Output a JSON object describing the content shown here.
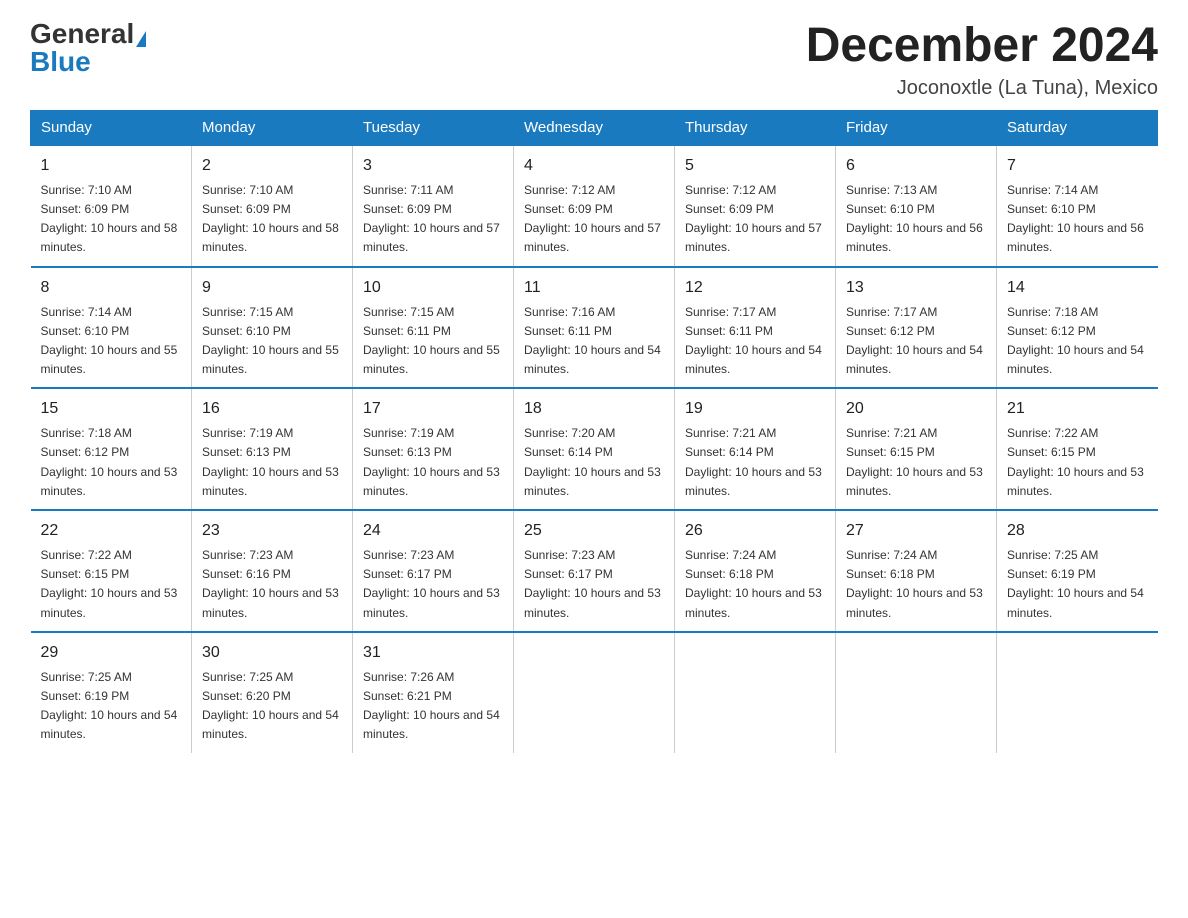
{
  "logo": {
    "general": "General",
    "blue": "Blue"
  },
  "title": "December 2024",
  "location": "Joconoxtle (La Tuna), Mexico",
  "days_of_week": [
    "Sunday",
    "Monday",
    "Tuesday",
    "Wednesday",
    "Thursday",
    "Friday",
    "Saturday"
  ],
  "weeks": [
    [
      {
        "day": "1",
        "sunrise": "7:10 AM",
        "sunset": "6:09 PM",
        "daylight": "10 hours and 58 minutes."
      },
      {
        "day": "2",
        "sunrise": "7:10 AM",
        "sunset": "6:09 PM",
        "daylight": "10 hours and 58 minutes."
      },
      {
        "day": "3",
        "sunrise": "7:11 AM",
        "sunset": "6:09 PM",
        "daylight": "10 hours and 57 minutes."
      },
      {
        "day": "4",
        "sunrise": "7:12 AM",
        "sunset": "6:09 PM",
        "daylight": "10 hours and 57 minutes."
      },
      {
        "day": "5",
        "sunrise": "7:12 AM",
        "sunset": "6:09 PM",
        "daylight": "10 hours and 57 minutes."
      },
      {
        "day": "6",
        "sunrise": "7:13 AM",
        "sunset": "6:10 PM",
        "daylight": "10 hours and 56 minutes."
      },
      {
        "day": "7",
        "sunrise": "7:14 AM",
        "sunset": "6:10 PM",
        "daylight": "10 hours and 56 minutes."
      }
    ],
    [
      {
        "day": "8",
        "sunrise": "7:14 AM",
        "sunset": "6:10 PM",
        "daylight": "10 hours and 55 minutes."
      },
      {
        "day": "9",
        "sunrise": "7:15 AM",
        "sunset": "6:10 PM",
        "daylight": "10 hours and 55 minutes."
      },
      {
        "day": "10",
        "sunrise": "7:15 AM",
        "sunset": "6:11 PM",
        "daylight": "10 hours and 55 minutes."
      },
      {
        "day": "11",
        "sunrise": "7:16 AM",
        "sunset": "6:11 PM",
        "daylight": "10 hours and 54 minutes."
      },
      {
        "day": "12",
        "sunrise": "7:17 AM",
        "sunset": "6:11 PM",
        "daylight": "10 hours and 54 minutes."
      },
      {
        "day": "13",
        "sunrise": "7:17 AM",
        "sunset": "6:12 PM",
        "daylight": "10 hours and 54 minutes."
      },
      {
        "day": "14",
        "sunrise": "7:18 AM",
        "sunset": "6:12 PM",
        "daylight": "10 hours and 54 minutes."
      }
    ],
    [
      {
        "day": "15",
        "sunrise": "7:18 AM",
        "sunset": "6:12 PM",
        "daylight": "10 hours and 53 minutes."
      },
      {
        "day": "16",
        "sunrise": "7:19 AM",
        "sunset": "6:13 PM",
        "daylight": "10 hours and 53 minutes."
      },
      {
        "day": "17",
        "sunrise": "7:19 AM",
        "sunset": "6:13 PM",
        "daylight": "10 hours and 53 minutes."
      },
      {
        "day": "18",
        "sunrise": "7:20 AM",
        "sunset": "6:14 PM",
        "daylight": "10 hours and 53 minutes."
      },
      {
        "day": "19",
        "sunrise": "7:21 AM",
        "sunset": "6:14 PM",
        "daylight": "10 hours and 53 minutes."
      },
      {
        "day": "20",
        "sunrise": "7:21 AM",
        "sunset": "6:15 PM",
        "daylight": "10 hours and 53 minutes."
      },
      {
        "day": "21",
        "sunrise": "7:22 AM",
        "sunset": "6:15 PM",
        "daylight": "10 hours and 53 minutes."
      }
    ],
    [
      {
        "day": "22",
        "sunrise": "7:22 AM",
        "sunset": "6:15 PM",
        "daylight": "10 hours and 53 minutes."
      },
      {
        "day": "23",
        "sunrise": "7:23 AM",
        "sunset": "6:16 PM",
        "daylight": "10 hours and 53 minutes."
      },
      {
        "day": "24",
        "sunrise": "7:23 AM",
        "sunset": "6:17 PM",
        "daylight": "10 hours and 53 minutes."
      },
      {
        "day": "25",
        "sunrise": "7:23 AM",
        "sunset": "6:17 PM",
        "daylight": "10 hours and 53 minutes."
      },
      {
        "day": "26",
        "sunrise": "7:24 AM",
        "sunset": "6:18 PM",
        "daylight": "10 hours and 53 minutes."
      },
      {
        "day": "27",
        "sunrise": "7:24 AM",
        "sunset": "6:18 PM",
        "daylight": "10 hours and 53 minutes."
      },
      {
        "day": "28",
        "sunrise": "7:25 AM",
        "sunset": "6:19 PM",
        "daylight": "10 hours and 54 minutes."
      }
    ],
    [
      {
        "day": "29",
        "sunrise": "7:25 AM",
        "sunset": "6:19 PM",
        "daylight": "10 hours and 54 minutes."
      },
      {
        "day": "30",
        "sunrise": "7:25 AM",
        "sunset": "6:20 PM",
        "daylight": "10 hours and 54 minutes."
      },
      {
        "day": "31",
        "sunrise": "7:26 AM",
        "sunset": "6:21 PM",
        "daylight": "10 hours and 54 minutes."
      },
      null,
      null,
      null,
      null
    ]
  ]
}
